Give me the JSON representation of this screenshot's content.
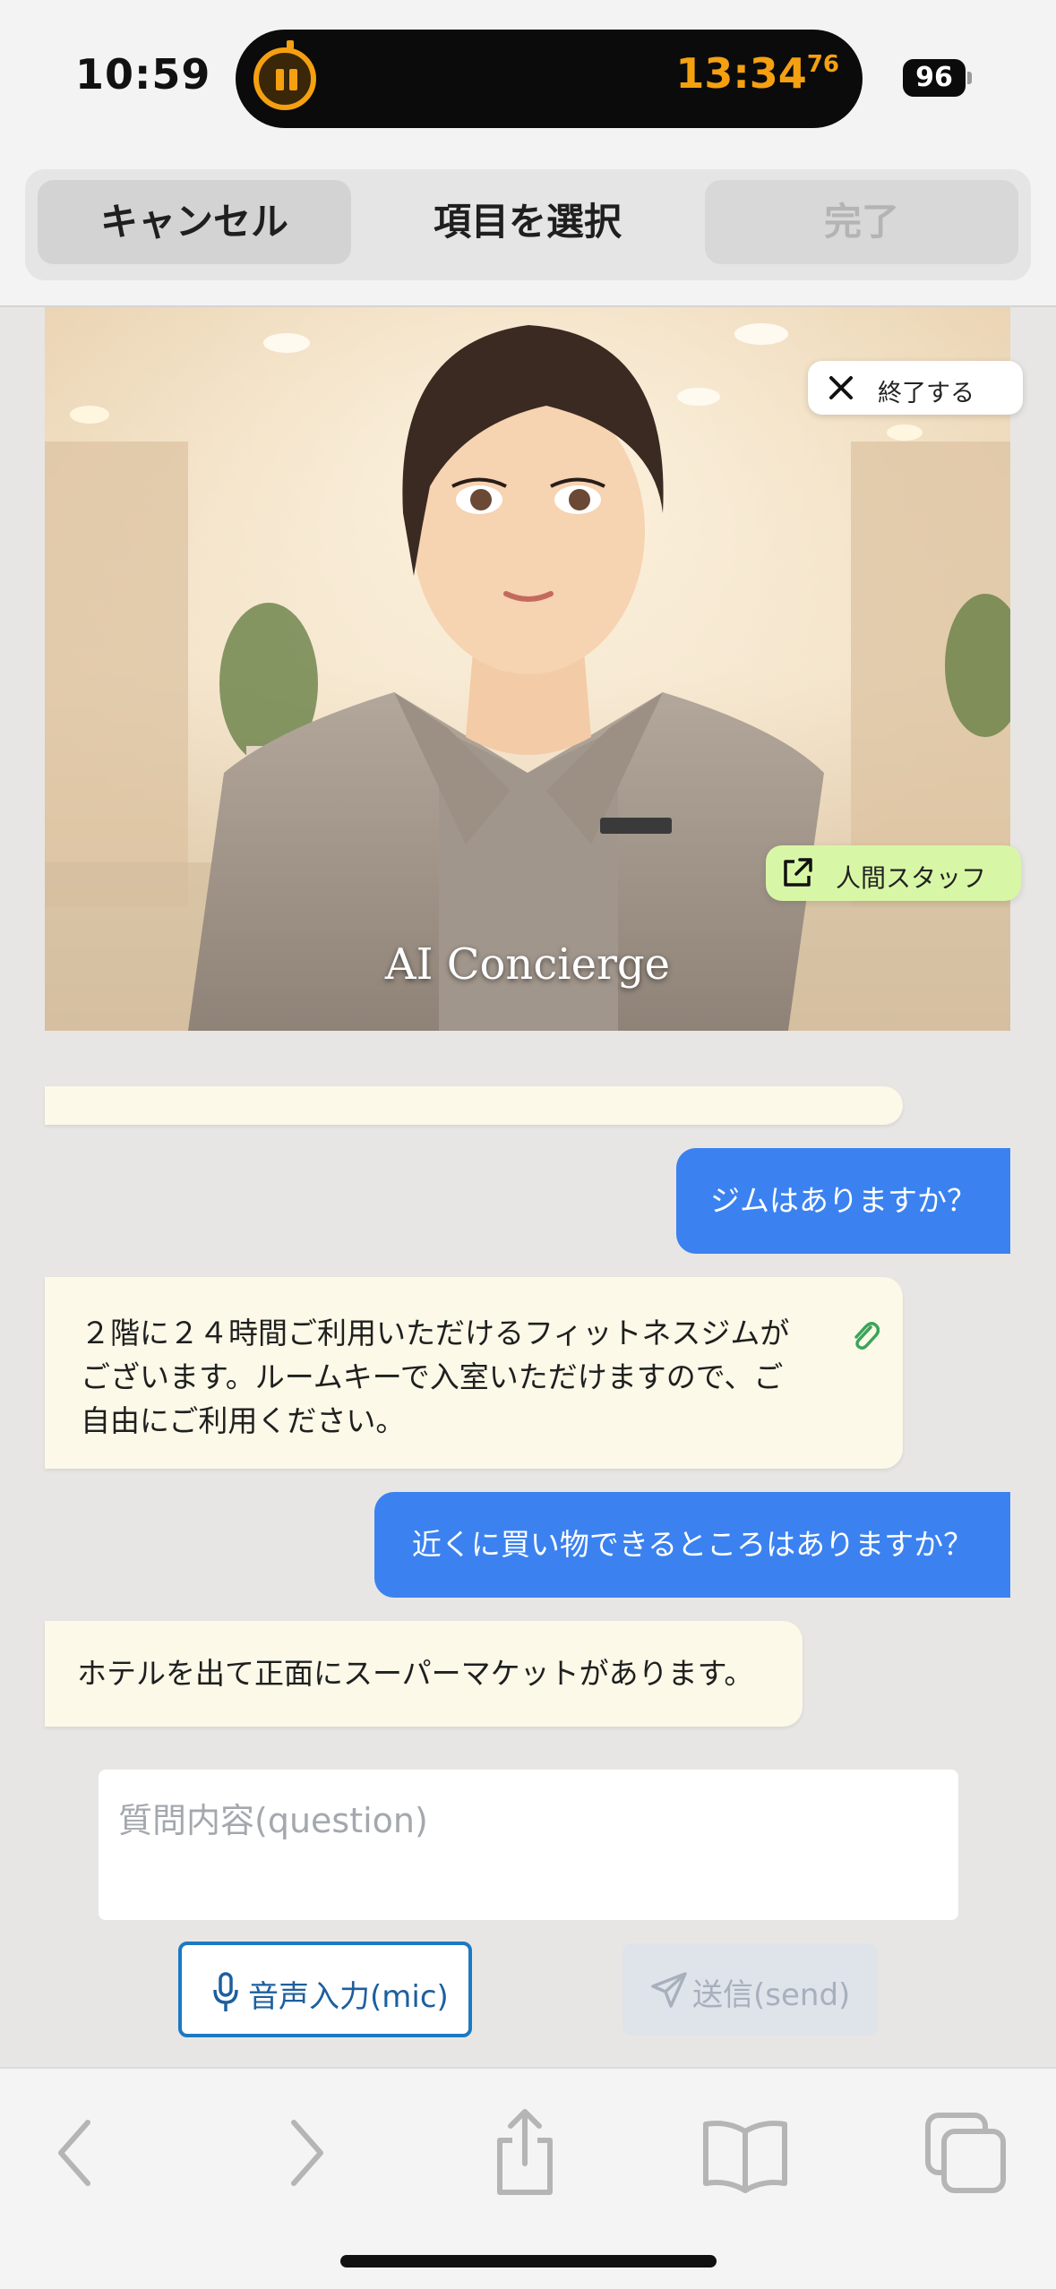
{
  "status_bar": {
    "time": "10:59",
    "timer": "13:34",
    "timer_fraction": "76",
    "battery": "96"
  },
  "selection_toolbar": {
    "cancel_label": "キャンセル",
    "title": "項目を選択",
    "done_label": "完了"
  },
  "hero": {
    "caption": "AI Concierge",
    "end_label": "終了する",
    "staff_label": "人間スタッフ"
  },
  "chat": {
    "messages": [
      {
        "role": "user",
        "text": "ジムはありますか？"
      },
      {
        "role": "ai",
        "lines": [
          "２階に２４時間ご利用いただけるフィットネスジムが",
          "ございます。ルームキーで入室いただけますので、ご",
          "自由にご利用ください。"
        ]
      },
      {
        "role": "user",
        "text": "近くに買い物できるところはありますか？"
      },
      {
        "role": "ai",
        "text": "ホテルを出て正面にスーパーマケットがあります。"
      }
    ]
  },
  "composer": {
    "placeholder": "質問内容(question)",
    "mic_label": "音声入力(mic)",
    "send_label": "送信(send)"
  },
  "colors": {
    "user_bubble": "#3b82f0",
    "ai_bubble": "#fcf9e8",
    "staff_button": "#d8f7a6",
    "timer": "#f4a011",
    "mic_border": "#1d79c2"
  },
  "icons": [
    "pause-timer-icon",
    "close-icon",
    "external-link-icon",
    "paperclip-icon",
    "microphone-icon",
    "paper-plane-icon",
    "back-icon",
    "forward-icon",
    "share-icon",
    "bookmarks-icon",
    "tabs-icon"
  ]
}
